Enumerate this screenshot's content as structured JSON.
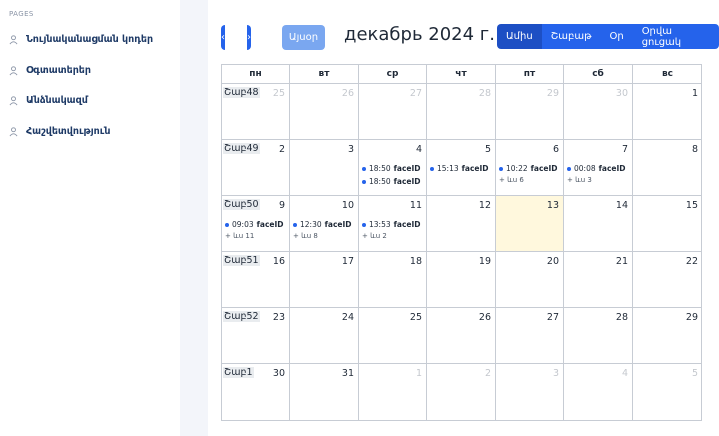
{
  "sidebar": {
    "section": "PAGES",
    "items": [
      {
        "label": "Նույնականացման կոդեր",
        "icon": "user-icon"
      },
      {
        "label": "Օգտատերեր",
        "icon": "user-icon"
      },
      {
        "label": "Անձնակազմ",
        "icon": "user-icon"
      },
      {
        "label": "Հաշվետվություն",
        "icon": "user-icon"
      }
    ]
  },
  "toolbar": {
    "prev_label": "‹",
    "next_label": "›",
    "today_label": "Այսօր",
    "title": "декабрь 2024 г.",
    "views": [
      "Ամիս",
      "Շաբաթ",
      "Օր",
      "Օրվա ցուցակ"
    ],
    "active_view": "Ամիս"
  },
  "colors": {
    "accent": "#2563eb",
    "today_bg": "#fff8dd",
    "event_dot": "#2563eb"
  },
  "calendar": {
    "weekdays": [
      "пн",
      "вт",
      "ср",
      "чт",
      "пт",
      "сб",
      "вс"
    ],
    "weeks": [
      {
        "week_label": "Շաբ48",
        "days": [
          {
            "num": "25",
            "other": true
          },
          {
            "num": "26",
            "other": true
          },
          {
            "num": "27",
            "other": true
          },
          {
            "num": "28",
            "other": true
          },
          {
            "num": "29",
            "other": true
          },
          {
            "num": "30",
            "other": true
          },
          {
            "num": "1"
          }
        ]
      },
      {
        "week_label": "Շաբ49",
        "days": [
          {
            "num": "2"
          },
          {
            "num": "3"
          },
          {
            "num": "4",
            "events": [
              {
                "time": "18:50",
                "title": "faceID"
              },
              {
                "time": "18:50",
                "title": "faceID"
              }
            ]
          },
          {
            "num": "5",
            "events": [
              {
                "time": "15:13",
                "title": "faceID"
              }
            ]
          },
          {
            "num": "6",
            "events": [
              {
                "time": "10:22",
                "title": "faceID"
              }
            ],
            "more": "+ ևս 6"
          },
          {
            "num": "7",
            "events": [
              {
                "time": "00:08",
                "title": "faceID"
              }
            ],
            "more": "+ ևս 3"
          },
          {
            "num": "8"
          }
        ]
      },
      {
        "week_label": "Շաբ50",
        "days": [
          {
            "num": "9",
            "events": [
              {
                "time": "09:03",
                "title": "faceID"
              }
            ],
            "more": "+ ևս 11"
          },
          {
            "num": "10",
            "events": [
              {
                "time": "12:30",
                "title": "faceID"
              }
            ],
            "more": "+ ևս 8"
          },
          {
            "num": "11",
            "events": [
              {
                "time": "13:53",
                "title": "faceID"
              }
            ],
            "more": "+ ևս 2"
          },
          {
            "num": "12"
          },
          {
            "num": "13",
            "today": true
          },
          {
            "num": "14"
          },
          {
            "num": "15"
          }
        ]
      },
      {
        "week_label": "Շաբ51",
        "days": [
          {
            "num": "16"
          },
          {
            "num": "17"
          },
          {
            "num": "18"
          },
          {
            "num": "19"
          },
          {
            "num": "20"
          },
          {
            "num": "21"
          },
          {
            "num": "22"
          }
        ]
      },
      {
        "week_label": "Շաբ52",
        "days": [
          {
            "num": "23"
          },
          {
            "num": "24"
          },
          {
            "num": "25"
          },
          {
            "num": "26"
          },
          {
            "num": "27"
          },
          {
            "num": "28"
          },
          {
            "num": "29"
          }
        ]
      },
      {
        "week_label": "Շաբ1",
        "days": [
          {
            "num": "30"
          },
          {
            "num": "31"
          },
          {
            "num": "1",
            "other": true
          },
          {
            "num": "2",
            "other": true
          },
          {
            "num": "3",
            "other": true
          },
          {
            "num": "4",
            "other": true
          },
          {
            "num": "5",
            "other": true
          }
        ]
      }
    ]
  }
}
